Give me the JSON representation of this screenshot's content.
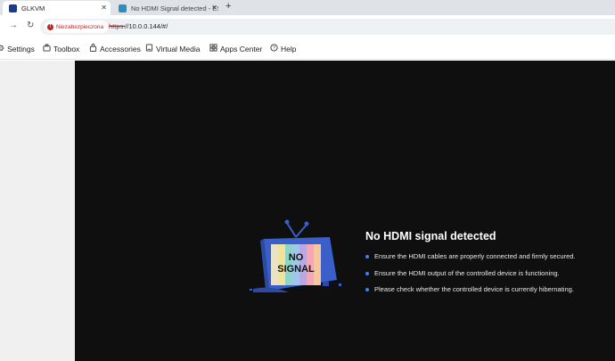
{
  "browser": {
    "tabs": [
      {
        "title": "GLKVM",
        "active": true
      },
      {
        "title": "No HDMI Signal detected - ESX",
        "active": false
      }
    ],
    "new_tab": "+",
    "security_chip": "Niezabezpieczona",
    "url_scheme": "https:",
    "url_rest": "//10.0.0.144/#/"
  },
  "menu": {
    "items": [
      {
        "label": "Settings",
        "icon": "gear-icon"
      },
      {
        "label": "Toolbox",
        "icon": "toolbox-icon"
      },
      {
        "label": "Accessories",
        "icon": "bag-icon"
      },
      {
        "label": "Virtual Media",
        "icon": "media-icon"
      },
      {
        "label": "Apps Center",
        "icon": "apps-icon"
      },
      {
        "label": "Help",
        "icon": "help-icon"
      }
    ]
  },
  "screen": {
    "tv_text_line1": "NO",
    "tv_text_line2": "SIGNAL",
    "headline": "No HDMI signal detected",
    "tips": [
      "Ensure the HDMI cables are properly connected and firmly secured.",
      "Ensure the HDMI output of the controlled device is functioning.",
      "Please check whether the controlled device is currently hibernating."
    ]
  },
  "colors": {
    "screen_bg": "#0f0f10",
    "tv_blue": "#3a5fc8",
    "bullet": "#3b82f6",
    "warning": "#c5221f"
  }
}
